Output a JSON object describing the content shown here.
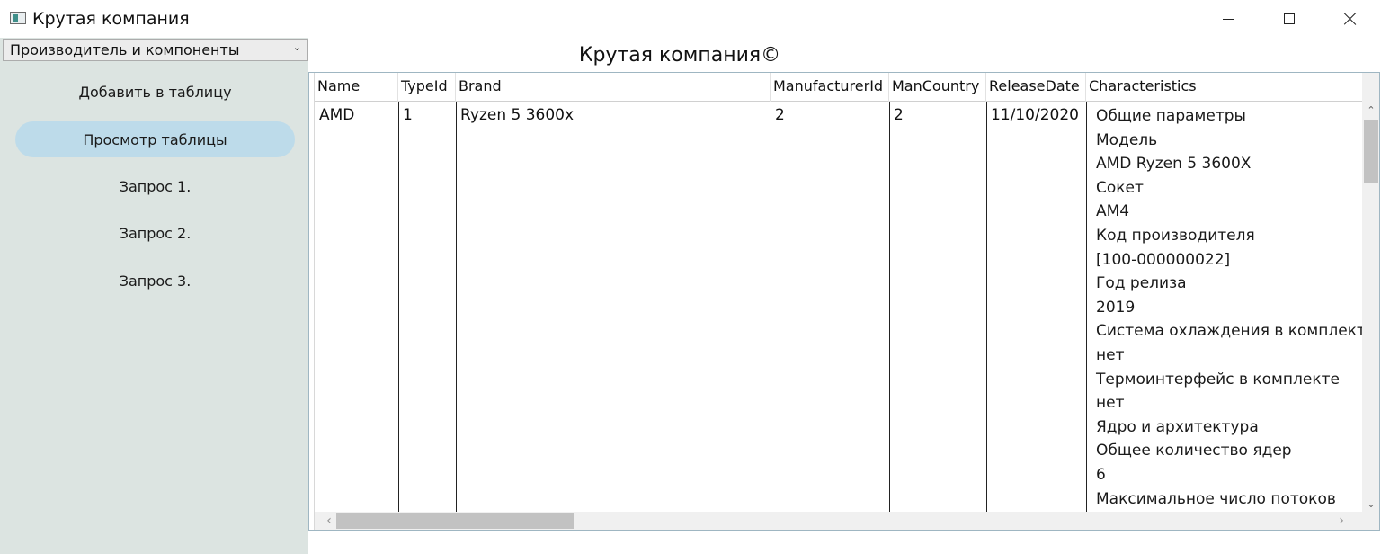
{
  "window": {
    "title": "Крутая компания"
  },
  "sidebar": {
    "dropdown_value": "Производитель и компоненты",
    "items": [
      {
        "label": "Добавить в таблицу"
      },
      {
        "label": "Просмотр таблицы"
      },
      {
        "label": "Запрос 1."
      },
      {
        "label": "Запрос 2."
      },
      {
        "label": "Запрос 3."
      }
    ]
  },
  "main": {
    "title": "Крутая компания©"
  },
  "table": {
    "columns": [
      "Name",
      "TypeId",
      "Brand",
      "ManufacturerId",
      "ManCountry",
      "ReleaseDate",
      "Characteristics"
    ],
    "row": {
      "name": "AMD",
      "type_id": "1",
      "brand": "Ryzen 5 3600x",
      "manufacturer_id": "2",
      "man_country": "2",
      "release_date": "11/10/2020",
      "characteristics": [
        "Общие параметры",
        "Модель",
        "AMD Ryzen 5 3600X",
        "Сокет",
        "AM4",
        "Код производителя",
        "[100-000000022]",
        "Год релиза",
        "2019",
        "Система охлаждения в комплект",
        "нет",
        "Термоинтерфейс в комплекте",
        "нет",
        "Ядро и архитектура",
        "Общее количество ядер",
        "6",
        "Максимальное число потоков"
      ]
    }
  }
}
